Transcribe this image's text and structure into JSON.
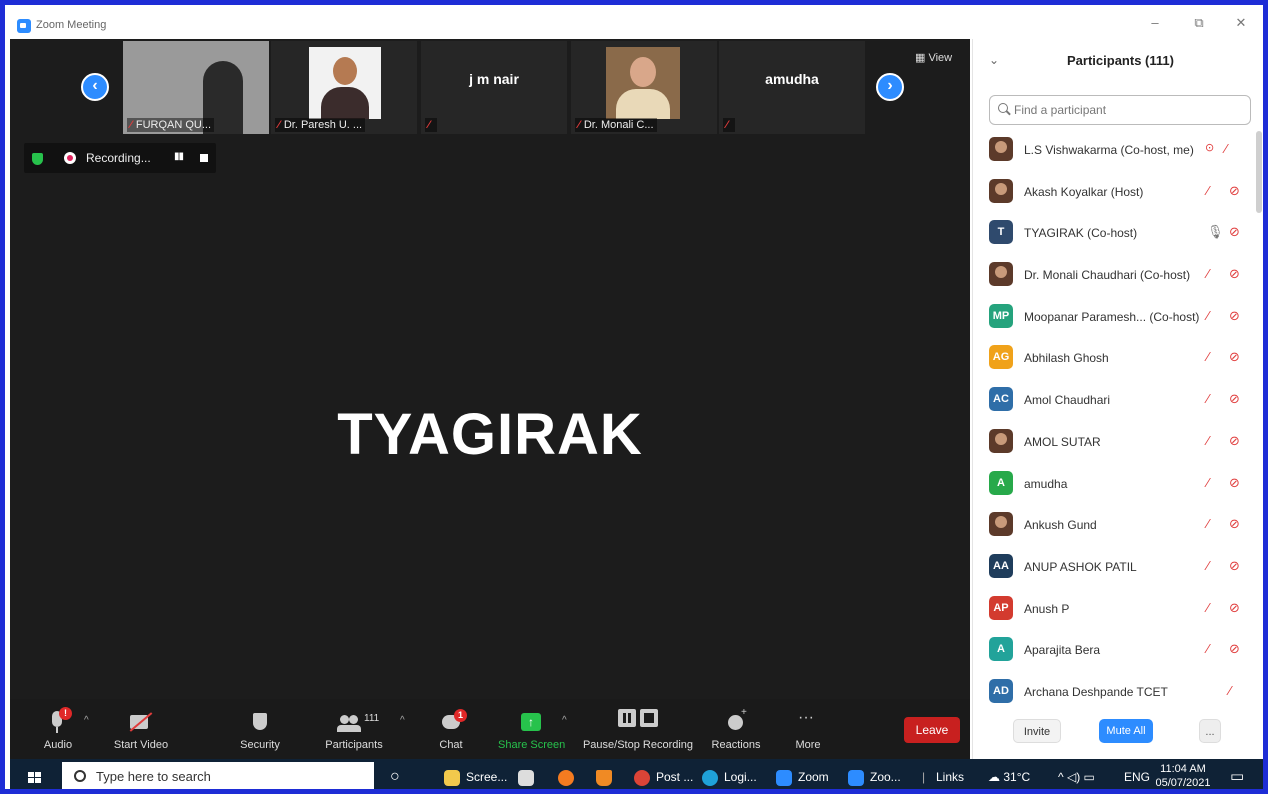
{
  "window": {
    "title": "Zoom Meeting",
    "controls": [
      "–",
      "⧉",
      "✕"
    ]
  },
  "thumbnails": [
    {
      "label": "FURQAN QU...",
      "center_name": ""
    },
    {
      "label": "Dr. Paresh U. ...",
      "center_name": ""
    },
    {
      "label": "",
      "center_name": "j m nair"
    },
    {
      "label": "Dr. Monali C... ",
      "center_name": ""
    },
    {
      "label": "",
      "center_name": "amudha"
    }
  ],
  "view_label": "View",
  "recording": {
    "text": "Recording..."
  },
  "active_speaker": "TYAGIRAK",
  "toolbar": {
    "audio": "Audio",
    "audio_badge": "!",
    "start_video": "Start Video",
    "security": "Security",
    "participants": "Participants",
    "participants_count": "111",
    "chat": "Chat",
    "chat_badge": "1",
    "share_screen": "Share Screen",
    "pause_stop_recording": "Pause/Stop Recording",
    "reactions": "Reactions",
    "more": "More",
    "leave": "Leave"
  },
  "panel": {
    "title": "Participants (111)",
    "search_placeholder": "Find a participant",
    "participants": [
      {
        "name": "L.S Vishwakarma (Co-host, me)",
        "initials": "",
        "color": "",
        "mic": "off",
        "video": "none"
      },
      {
        "name": "Akash Koyalkar (Host)",
        "initials": "",
        "color": "",
        "mic": "off",
        "video": "off"
      },
      {
        "name": "TYAGIRAK (Co-host)",
        "initials": "T",
        "color": "#2f4a6d",
        "mic": "on",
        "video": "off"
      },
      {
        "name": "Dr. Monali Chaudhari (Co-host)",
        "initials": "",
        "color": "",
        "mic": "off",
        "video": "off"
      },
      {
        "name": "Moopanar Paramesh... (Co-host)",
        "initials": "MP",
        "color": "#25a37d",
        "mic": "off",
        "video": "off"
      },
      {
        "name": "Abhilash Ghosh",
        "initials": "AG",
        "color": "#f0a21a",
        "mic": "off",
        "video": "off"
      },
      {
        "name": "Amol Chaudhari",
        "initials": "AC",
        "color": "#2f6ea8",
        "mic": "off",
        "video": "off"
      },
      {
        "name": "AMOL SUTAR",
        "initials": "",
        "color": "",
        "mic": "off",
        "video": "off"
      },
      {
        "name": "amudha",
        "initials": "A",
        "color": "#27a94a",
        "mic": "off",
        "video": "off"
      },
      {
        "name": "Ankush Gund",
        "initials": "",
        "color": "",
        "mic": "off",
        "video": "off"
      },
      {
        "name": "ANUP ASHOK PATIL",
        "initials": "AA",
        "color": "#1f3d5c",
        "mic": "off",
        "video": "off"
      },
      {
        "name": "Anush P",
        "initials": "AP",
        "color": "#d33b2f",
        "mic": "off",
        "video": "off"
      },
      {
        "name": "Aparajita Bera",
        "initials": "A",
        "color": "#22a39a",
        "mic": "off",
        "video": "off"
      },
      {
        "name": "Archana Deshpande TCET",
        "initials": "AD",
        "color": "#2f6ea8",
        "mic": "off",
        "video": "none"
      }
    ],
    "invite": "Invite",
    "mute_all": "Mute All",
    "more": "..."
  },
  "taskbar": {
    "search_placeholder": "Type here to search",
    "apps": [
      "Scree...",
      "Post ...",
      "Logi...",
      "Zoom",
      "Zoo..."
    ],
    "links": "Links",
    "weather": "31°C",
    "lang": "ENG",
    "time": "11:04 AM",
    "date": "05/07/2021"
  }
}
